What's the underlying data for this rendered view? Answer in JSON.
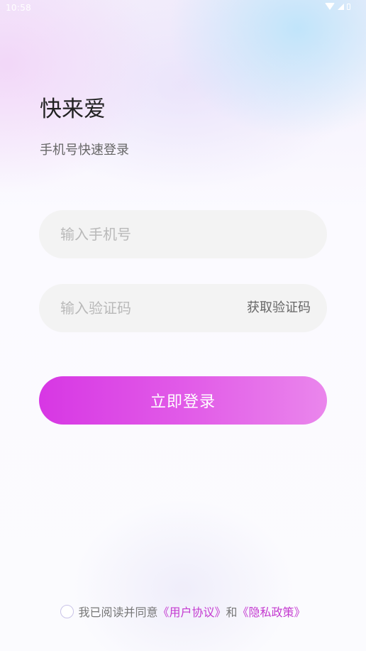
{
  "status_bar": {
    "time": "10:58",
    "icons": [
      "wifi-icon",
      "signal-icon",
      "battery-icon"
    ]
  },
  "header": {
    "app_title": "快来爱",
    "subtitle": "手机号快速登录"
  },
  "form": {
    "phone_placeholder": "输入手机号",
    "phone_value": "",
    "code_placeholder": "输入验证码",
    "code_value": "",
    "get_code_label": "获取验证码",
    "login_label": "立即登录"
  },
  "agreement": {
    "checked": false,
    "prefix": "我已阅读并同意",
    "user_agreement": "《用户协议》",
    "conjunction": "和",
    "privacy_policy": "《隐私政策》"
  },
  "colors": {
    "accent_start": "#d737e4",
    "accent_end": "#ea86ec",
    "link": "#c43ad0",
    "input_bg": "#f3f3f3"
  }
}
